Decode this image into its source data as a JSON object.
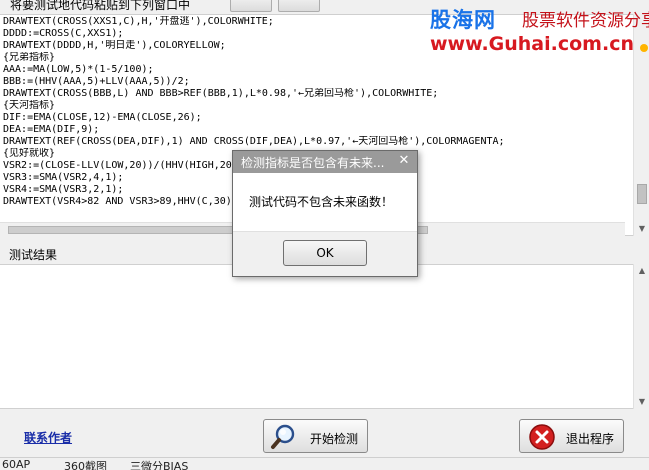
{
  "toolbar": {
    "instruction": "将要测试地代码粘贴到下列窗口中"
  },
  "watermark": {
    "brand": "股海网",
    "tagline": "股票软件资源分享",
    "url": "www.Guhai.com.cn"
  },
  "code_editor": {
    "lines": [
      "DRAWTEXT(CROSS(XXS1,C),H,'开盘逃'),COLORWHITE;",
      "DDDD:=CROSS(C,XXS1);",
      "DRAWTEXT(DDDD,H,'明日走'),COLORYELLOW;",
      "{兄弟指标}",
      "AAA:=MA(LOW,5)*(1-5/100);",
      "BBB:=(HHV(AAA,5)+LLV(AAA,5))/2;",
      "DRAWTEXT(CROSS(BBB,L) AND BBB>REF(BBB,1),L*0.98,'←兄弟回马枪'),COLORWHITE;",
      "{天河指标}",
      "DIF:=EMA(CLOSE,12)-EMA(CLOSE,26);",
      "DEA:=EMA(DIF,9);",
      "DRAWTEXT(REF(CROSS(DEA,DIF),1) AND CROSS(DIF,DEA),L*0.97,'←天河回马枪'),COLORMAGENTA;",
      "{见好就收}",
      "VSR2:=(CLOSE-LLV(LOW,20))/(HHV(HIGH,20)",
      "VSR3:=SMA(VSR2,4,1);",
      "VSR4:=SMA(VSR3,2,1);",
      "DRAWTEXT(VSR4>82 AND VSR3>89,HHV(C,30)"
    ]
  },
  "results": {
    "label": "测试结果",
    "content": ""
  },
  "bottom": {
    "contact_link": "联系作者",
    "start_button": "开始检测",
    "exit_button": "退出程序"
  },
  "status_bar": {
    "items": [
      "60AP",
      "360截图",
      "三微分BIAS"
    ]
  },
  "dialog": {
    "title": "检测指标是否包含有未来...",
    "close_glyph": "✕",
    "message": "测试代码不包含未来函数！",
    "ok_label": "OK"
  },
  "icons": {
    "start_icon": "magnifier-icon",
    "exit_icon": "stop-icon",
    "dialog_close": "close-icon"
  },
  "colors": {
    "exit_icon_red": "#d32020",
    "link_blue": "#1a2ea8",
    "watermark_blue": "#1a73e8",
    "watermark_red": "#d71920"
  }
}
